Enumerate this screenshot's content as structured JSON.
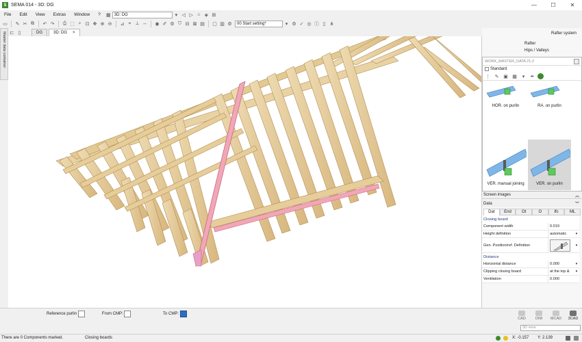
{
  "window": {
    "title": "SEMA  014  - 3D: DG",
    "logo": "S",
    "minimize": "—",
    "maximize": "☐",
    "close": "✕"
  },
  "menu": [
    "File",
    "Edit",
    "View",
    "Extras",
    "Window",
    "?"
  ],
  "toolbar": {
    "view_select": "3D: DG",
    "setting_select": "00 Start setting*"
  },
  "side_strip": {
    "label": "Master data container"
  },
  "tabs": [
    {
      "label": "DG",
      "active": false
    },
    {
      "label": "3D: DG",
      "active": true,
      "close": "×"
    }
  ],
  "right_panel": {
    "title": "Rafter system",
    "links": [
      "Rafter",
      "Hips / Valleys"
    ],
    "master_header": "WORK_MASTER_DATA 21-2",
    "standard": "Standard",
    "tiles": [
      {
        "label": "HOR. on purlin",
        "selected": false
      },
      {
        "label": "RA. on purlin",
        "selected": false
      },
      {
        "label": "VER. manual joining",
        "selected": false
      },
      {
        "label": "VER. on purlin",
        "selected": true
      }
    ],
    "screen_images": "Screen images",
    "data_title": "Data",
    "data_tabs": [
      "Dat",
      "End",
      "Ot",
      "O",
      "Ifc",
      "ML"
    ],
    "section_closing": "Closing board",
    "props": [
      {
        "label": "Component width",
        "value": "0.019"
      },
      {
        "label": "Height definition",
        "value": "automatic"
      },
      {
        "label": "Gen. Position/ref. Definition",
        "value": ""
      }
    ],
    "section_distance": "Distance",
    "props2": [
      {
        "label": "Horizontal distance",
        "value": "0.000"
      },
      {
        "label": "Clipping closing board",
        "value": "at the top &"
      },
      {
        "label": "Ventilation",
        "value": "0.000"
      }
    ]
  },
  "bottom": {
    "reference_purlin": "Reference purlin",
    "from_cmp": "From CMP:",
    "to_cmp": "To CMP:",
    "modes": [
      {
        "label": "CAD",
        "active": false
      },
      {
        "label": "DIM",
        "active": false
      },
      {
        "label": "MCAD",
        "active": false
      },
      {
        "label": "3CAD",
        "active": true
      }
    ],
    "view_select": "3D view"
  },
  "status": {
    "message": "There are 0 Components marked.",
    "mode": "Closing boards",
    "x": "X: -0.157",
    "y": "Y: 2.139"
  },
  "colors": {
    "wood": "#e7cf9f",
    "wood_dark": "#c9a869",
    "highlight": "#f1a7b6",
    "accent_green": "#3c8a2e",
    "select_blue": "#2a6fc4"
  }
}
